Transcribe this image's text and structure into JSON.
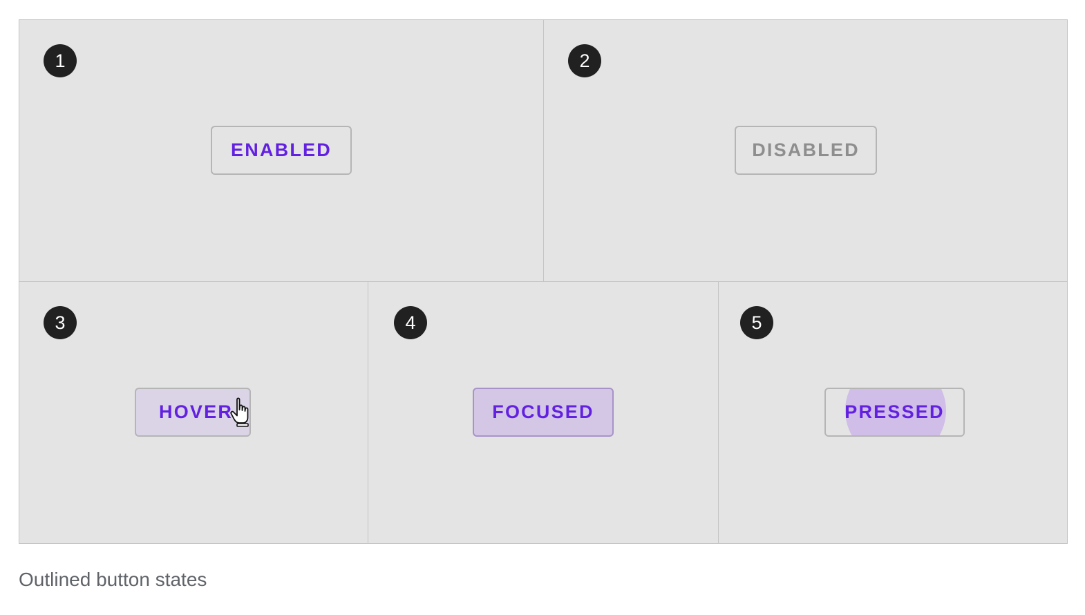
{
  "panels": [
    {
      "number": "1",
      "button_label": "ENABLED"
    },
    {
      "number": "2",
      "button_label": "DISABLED"
    },
    {
      "number": "3",
      "button_label": "HOVER"
    },
    {
      "number": "4",
      "button_label": "FOCUSED"
    },
    {
      "number": "5",
      "button_label": "PRESSED"
    }
  ],
  "caption": "Outlined button states",
  "colors": {
    "primary_text": "#6221e0",
    "disabled_text": "#8e8e8e",
    "hover_fill": "#dbd3e6",
    "focus_fill": "#d4c7e6",
    "ripple_fill": "#d0bde8",
    "badge_fill": "#212121",
    "board_background": "#e4e4e4"
  },
  "icons": {
    "cursor": "hand-pointer-icon"
  }
}
